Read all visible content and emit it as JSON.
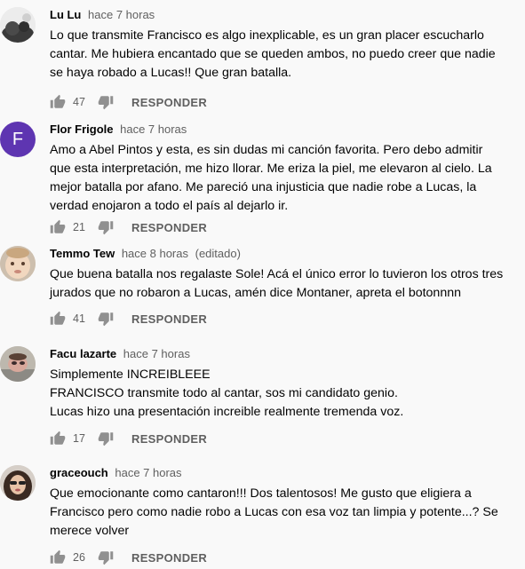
{
  "actions": {
    "reply_label": "RESPONDER"
  },
  "comments": [
    {
      "author": "Lu Lu",
      "time": "hace 7 horas",
      "edited": "",
      "avatar": "photo",
      "text": "Lo que transmite Francisco es algo inexplicable, es un gran placer escucharlo\ncantar. Me hubiera encantado que se queden ambos, no puedo creer que nadie\nse haya robado a Lucas!! Que gran batalla.",
      "likes": "47"
    },
    {
      "author": "Flor Frigole",
      "time": "hace 7 horas",
      "edited": "",
      "avatar": "letter",
      "avatar_letter": "F",
      "avatar_color": "#5e35b1",
      "text": "Amo a Abel Pintos y esta, es sin dudas mi canción favorita. Pero debo admitir\nque esta interpretación, me hizo llorar. Me eriza la piel, me elevaron al cielo. La\nmejor batalla por afano. Me pareció una injusticia que nadie robe a Lucas, la\nverdad enojaron a todo el país al dejarlo ir.",
      "likes": "21"
    },
    {
      "author": "Temmo Tew",
      "time": "hace 8 horas",
      "edited": "(editado)",
      "avatar": "photo",
      "text": "Que buena batalla nos regalaste Sole! Acá el único error lo tuvieron los otros tres\njurados que no robaron a Lucas, amén dice Montaner, apreta el botonnnn",
      "likes": "41"
    },
    {
      "author": "Facu lazarte",
      "time": "hace 7 horas",
      "edited": "",
      "avatar": "photo",
      "text": "Simplemente INCREIBLEEE\nFRANCISCO transmite todo al cantar, sos mi candidato genio.\nLucas hizo una presentación increible realmente tremenda voz.",
      "likes": "17"
    },
    {
      "author": "graceouch",
      "time": "hace 7 horas",
      "edited": "",
      "avatar": "photo",
      "text": "Que emocionante como cantaron!!! Dos talentosos! Me gusto que eligiera a\nFrancisco pero como nadie robo a Lucas con esa voz tan limpia y potente...?  Se\nmerece volver",
      "likes": "26"
    }
  ]
}
